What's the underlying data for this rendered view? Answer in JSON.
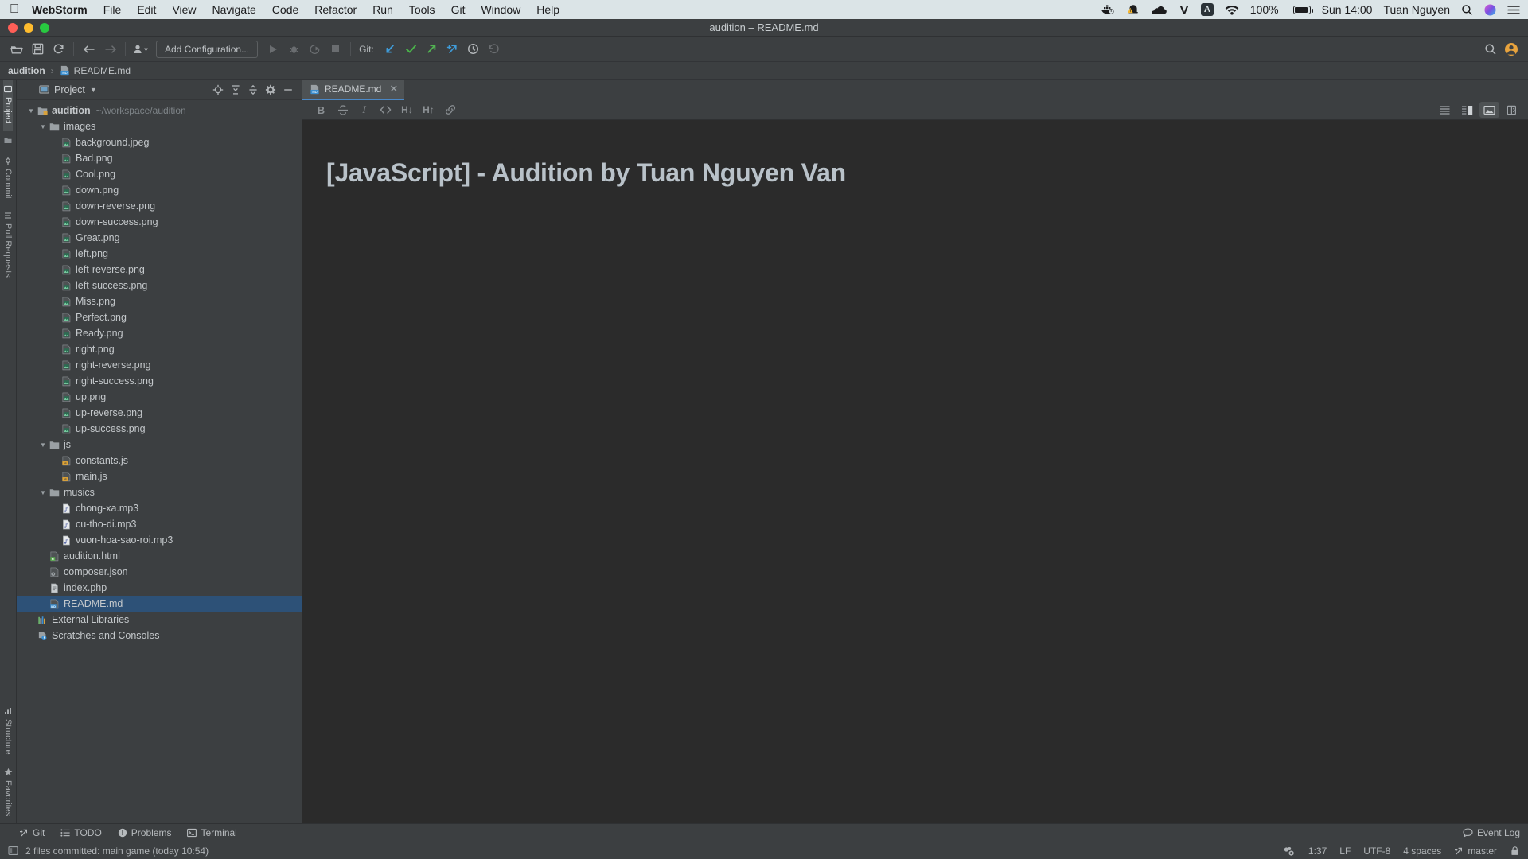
{
  "macos_menubar": {
    "apple_icon": "apple-logo-icon",
    "app_name": "WebStorm",
    "menus": [
      "File",
      "Edit",
      "View",
      "Navigate",
      "Code",
      "Refactor",
      "Run",
      "Tools",
      "Git",
      "Window",
      "Help"
    ],
    "status_icons": [
      "docker-icon",
      "bell-alert-icon",
      "cloud-icon",
      "vpn-v-icon",
      "alfred-a-icon",
      "wifi-icon"
    ],
    "battery_percent": "100%",
    "battery_icon": "battery-charging-icon",
    "clock": "Sun 14:00",
    "user": "Tuan Nguyen",
    "spotlight_icon": "search-icon",
    "siri_icon": "siri-icon",
    "control_center_icon": "control-center-icon"
  },
  "window": {
    "title": "audition – README.md",
    "traffic_lights": [
      "close",
      "minimize",
      "zoom"
    ]
  },
  "toolbar": {
    "open_icon": "open-folder-icon",
    "save_icon": "save-icon",
    "sync_icon": "refresh-icon",
    "back_icon": "arrow-back-icon",
    "forward_icon": "arrow-forward-icon",
    "profile_icon": "user-settings-icon",
    "run_config": "Add Configuration...",
    "run_icon": "run-play-icon",
    "debug_icon": "debug-bug-icon",
    "coverage_icon": "run-coverage-icon",
    "stop_icon": "stop-square-icon",
    "git_label": "Git:",
    "git_update_icon": "git-update-arrow-icon",
    "git_commit_icon": "git-commit-check-icon",
    "git_push_icon": "git-push-arrow-icon",
    "git_branch_icon": "git-branch-icon",
    "history_icon": "clock-history-icon",
    "rollback_icon": "rollback-undo-icon",
    "search_everywhere_icon": "search-icon",
    "settings_avatar_icon": "user-avatar-icon"
  },
  "breadcrumbs": {
    "project": "audition",
    "separator": "›",
    "file": "README.md",
    "file_icon": "markdown-file-icon"
  },
  "left_rail": {
    "top": [
      {
        "label": "Project",
        "icon": "project-folder-icon",
        "active": true
      },
      {
        "label": "Commit",
        "icon": "commit-icon",
        "active": false
      },
      {
        "label": "Pull Requests",
        "icon": "pull-request-icon",
        "active": false
      }
    ],
    "bottom": [
      {
        "label": "Structure",
        "icon": "structure-icon",
        "active": false
      },
      {
        "label": "Favorites",
        "icon": "star-icon",
        "active": false
      }
    ]
  },
  "project_panel": {
    "title": "Project",
    "view_icon": "project-view-icon",
    "dropdown_icon": "chevron-down-icon",
    "actions": [
      {
        "name": "locate-icon",
        "label": ""
      },
      {
        "name": "expand-all-icon",
        "label": ""
      },
      {
        "name": "collapse-all-icon",
        "label": ""
      },
      {
        "name": "gear-icon",
        "label": ""
      },
      {
        "name": "hide-icon",
        "label": ""
      }
    ],
    "tree": [
      {
        "depth": 0,
        "label": "audition",
        "path": "~/workspace/audition",
        "icon": "folder-module-icon",
        "arrow": "expanded",
        "bold": true,
        "selected": false
      },
      {
        "depth": 1,
        "label": "images",
        "path": "",
        "icon": "folder-icon",
        "arrow": "expanded",
        "bold": false,
        "selected": false
      },
      {
        "depth": 2,
        "label": "background.jpeg",
        "path": "",
        "icon": "image-file-icon",
        "arrow": "",
        "bold": false,
        "selected": false
      },
      {
        "depth": 2,
        "label": "Bad.png",
        "path": "",
        "icon": "image-file-icon",
        "arrow": "",
        "bold": false,
        "selected": false
      },
      {
        "depth": 2,
        "label": "Cool.png",
        "path": "",
        "icon": "image-file-icon",
        "arrow": "",
        "bold": false,
        "selected": false
      },
      {
        "depth": 2,
        "label": "down.png",
        "path": "",
        "icon": "image-file-icon",
        "arrow": "",
        "bold": false,
        "selected": false
      },
      {
        "depth": 2,
        "label": "down-reverse.png",
        "path": "",
        "icon": "image-file-icon",
        "arrow": "",
        "bold": false,
        "selected": false
      },
      {
        "depth": 2,
        "label": "down-success.png",
        "path": "",
        "icon": "image-file-icon",
        "arrow": "",
        "bold": false,
        "selected": false
      },
      {
        "depth": 2,
        "label": "Great.png",
        "path": "",
        "icon": "image-file-icon",
        "arrow": "",
        "bold": false,
        "selected": false
      },
      {
        "depth": 2,
        "label": "left.png",
        "path": "",
        "icon": "image-file-icon",
        "arrow": "",
        "bold": false,
        "selected": false
      },
      {
        "depth": 2,
        "label": "left-reverse.png",
        "path": "",
        "icon": "image-file-icon",
        "arrow": "",
        "bold": false,
        "selected": false
      },
      {
        "depth": 2,
        "label": "left-success.png",
        "path": "",
        "icon": "image-file-icon",
        "arrow": "",
        "bold": false,
        "selected": false
      },
      {
        "depth": 2,
        "label": "Miss.png",
        "path": "",
        "icon": "image-file-icon",
        "arrow": "",
        "bold": false,
        "selected": false
      },
      {
        "depth": 2,
        "label": "Perfect.png",
        "path": "",
        "icon": "image-file-icon",
        "arrow": "",
        "bold": false,
        "selected": false
      },
      {
        "depth": 2,
        "label": "Ready.png",
        "path": "",
        "icon": "image-file-icon",
        "arrow": "",
        "bold": false,
        "selected": false
      },
      {
        "depth": 2,
        "label": "right.png",
        "path": "",
        "icon": "image-file-icon",
        "arrow": "",
        "bold": false,
        "selected": false
      },
      {
        "depth": 2,
        "label": "right-reverse.png",
        "path": "",
        "icon": "image-file-icon",
        "arrow": "",
        "bold": false,
        "selected": false
      },
      {
        "depth": 2,
        "label": "right-success.png",
        "path": "",
        "icon": "image-file-icon",
        "arrow": "",
        "bold": false,
        "selected": false
      },
      {
        "depth": 2,
        "label": "up.png",
        "path": "",
        "icon": "image-file-icon",
        "arrow": "",
        "bold": false,
        "selected": false
      },
      {
        "depth": 2,
        "label": "up-reverse.png",
        "path": "",
        "icon": "image-file-icon",
        "arrow": "",
        "bold": false,
        "selected": false
      },
      {
        "depth": 2,
        "label": "up-success.png",
        "path": "",
        "icon": "image-file-icon",
        "arrow": "",
        "bold": false,
        "selected": false
      },
      {
        "depth": 1,
        "label": "js",
        "path": "",
        "icon": "folder-icon",
        "arrow": "expanded",
        "bold": false,
        "selected": false
      },
      {
        "depth": 2,
        "label": "constants.js",
        "path": "",
        "icon": "javascript-file-icon",
        "arrow": "",
        "bold": false,
        "selected": false
      },
      {
        "depth": 2,
        "label": "main.js",
        "path": "",
        "icon": "javascript-file-icon",
        "arrow": "",
        "bold": false,
        "selected": false
      },
      {
        "depth": 1,
        "label": "musics",
        "path": "",
        "icon": "folder-icon",
        "arrow": "expanded",
        "bold": false,
        "selected": false
      },
      {
        "depth": 2,
        "label": "chong-xa.mp3",
        "path": "",
        "icon": "audio-file-icon",
        "arrow": "",
        "bold": false,
        "selected": false
      },
      {
        "depth": 2,
        "label": "cu-tho-di.mp3",
        "path": "",
        "icon": "audio-file-icon",
        "arrow": "",
        "bold": false,
        "selected": false
      },
      {
        "depth": 2,
        "label": "vuon-hoa-sao-roi.mp3",
        "path": "",
        "icon": "audio-file-icon",
        "arrow": "",
        "bold": false,
        "selected": false
      },
      {
        "depth": 1,
        "label": "audition.html",
        "path": "",
        "icon": "html-file-icon",
        "arrow": "",
        "bold": false,
        "selected": false
      },
      {
        "depth": 1,
        "label": "composer.json",
        "path": "",
        "icon": "json-file-icon",
        "arrow": "",
        "bold": false,
        "selected": false
      },
      {
        "depth": 1,
        "label": "index.php",
        "path": "",
        "icon": "php-file-icon",
        "arrow": "",
        "bold": false,
        "selected": false
      },
      {
        "depth": 1,
        "label": "README.md",
        "path": "",
        "icon": "markdown-file-icon",
        "arrow": "",
        "bold": false,
        "selected": true
      },
      {
        "depth": 0,
        "label": "External Libraries",
        "path": "",
        "icon": "libraries-icon",
        "arrow": "",
        "bold": false,
        "selected": false
      },
      {
        "depth": 0,
        "label": "Scratches and Consoles",
        "path": "",
        "icon": "scratches-icon",
        "arrow": "",
        "bold": false,
        "selected": false
      }
    ]
  },
  "editor": {
    "tab": {
      "label": "README.md",
      "icon": "markdown-file-icon",
      "close_icon": "close-icon"
    },
    "md_toolbar": [
      {
        "name": "bold-button",
        "label": "B"
      },
      {
        "name": "strikethrough-button",
        "label": "S"
      },
      {
        "name": "italic-button",
        "label": "I"
      },
      {
        "name": "code-button",
        "label": "<>"
      },
      {
        "name": "heading-down-button",
        "label": "H↓"
      },
      {
        "name": "heading-up-button",
        "label": "H↑"
      },
      {
        "name": "link-button",
        "label": "⊘"
      }
    ],
    "view_modes": [
      {
        "name": "editor-only-button",
        "active": false
      },
      {
        "name": "editor-and-preview-button",
        "active": false
      },
      {
        "name": "preview-only-button",
        "active": true
      },
      {
        "name": "auto-scroll-preview-button",
        "active": false
      }
    ],
    "preview_heading": "[JavaScript] - Audition by Tuan Nguyen Van"
  },
  "bottom_strip": {
    "items": [
      {
        "label": "Git",
        "icon": "git-branch-icon"
      },
      {
        "label": "TODO",
        "icon": "todo-list-icon"
      },
      {
        "label": "Problems",
        "icon": "problems-warning-icon"
      },
      {
        "label": "Terminal",
        "icon": "terminal-icon"
      }
    ]
  },
  "status_bar": {
    "message_icon": "notification-icon",
    "message": "2 files committed: main game (today 10:54)",
    "event_log": "Event Log",
    "event_log_icon": "event-log-icon",
    "inspection_icon": "inspections-icon",
    "caret_position": "1:37",
    "line_separator": "LF",
    "encoding": "UTF-8",
    "indent": "4 spaces",
    "branch": "master",
    "branch_icon": "git-branch-icon",
    "lock_icon": "lock-icon"
  },
  "colors": {
    "ide_bg": "#3c3f41",
    "editor_bg": "#2b2b2b",
    "selection": "#2d5177",
    "tab_underline": "#4a88c7",
    "menubar_bg": "#dbe4e7",
    "text": "#c4c8cb"
  }
}
